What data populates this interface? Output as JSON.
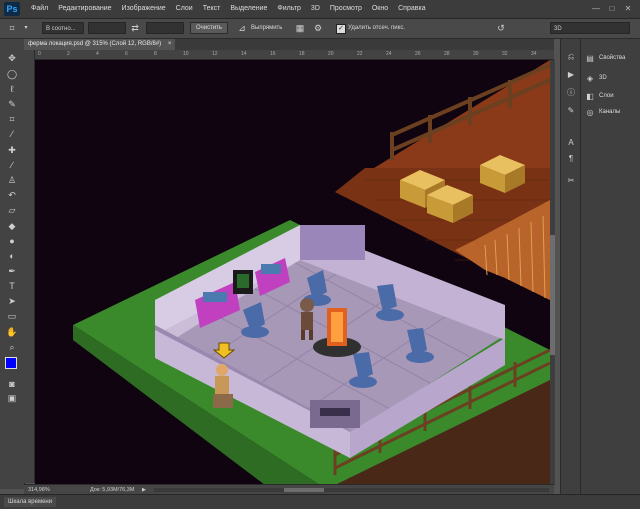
{
  "app": {
    "logo": "Ps"
  },
  "menu": [
    "Файл",
    "Редактирование",
    "Изображение",
    "Слои",
    "Текст",
    "Выделение",
    "Фильтр",
    "3D",
    "Просмотр",
    "Окно",
    "Справка"
  ],
  "window_controls": [
    "—",
    "□",
    "✕"
  ],
  "options": {
    "ratio_select": "В соотно...",
    "clear_button": "Очистить",
    "straighten_label": "Выпрямить",
    "delete_pixels_label": "Удалить отсеч. пикс.",
    "delete_pixels_checked": true,
    "workspace_select": "3D"
  },
  "document_tab": {
    "title": "ферма локация.psd @ 315% (Слой 12, RGB/8#)",
    "close": "×"
  },
  "ruler_top_ticks": [
    "0",
    "2",
    "4",
    "6",
    "8",
    "10",
    "12",
    "14",
    "16",
    "18",
    "20",
    "22",
    "24",
    "26",
    "28",
    "30",
    "32",
    "34"
  ],
  "status": {
    "zoom": "314,98%",
    "doc": "Док: 5,93M/76,3M"
  },
  "timeline_label": "Шкала времени",
  "panels": [
    {
      "icon": "properties-icon",
      "glyph": "▤",
      "label": "Свойства"
    },
    {
      "icon": "3d-icon",
      "glyph": "◈",
      "label": "3D"
    },
    {
      "icon": "layers-icon",
      "glyph": "◧",
      "label": "Слои"
    },
    {
      "icon": "channels-icon",
      "glyph": "◎",
      "label": "Каналы"
    }
  ],
  "colors": {
    "foreground": "#0000ff",
    "background": "#ffffff",
    "grass": "#3a8a2c",
    "soil": "#8a3a18",
    "floor": "#a898b8"
  }
}
